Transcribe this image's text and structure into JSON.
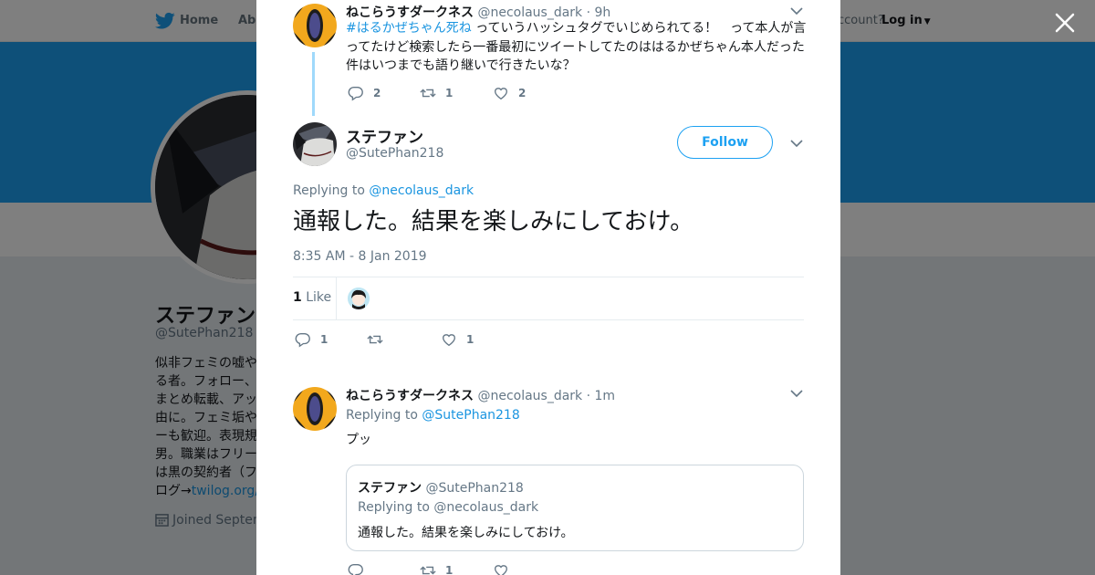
{
  "background": {
    "nav": {
      "home_label": "Home",
      "about_label": "Abo",
      "have_account_text": "ccount?",
      "login_label": "Log in"
    },
    "profile": {
      "name": "ステファン",
      "handle": "@SutePhan218",
      "bio_lines": [
        "似非フェミの嘘や",
        "る者。フォロー、",
        "まとめ転載、アッ",
        "由に。フェミ垢や",
        "ーも歓迎。表現規",
        "男。職業はフリー",
        "は黒の契約者（フ"
      ],
      "bio_last_prefix": "ログ→",
      "bio_link": "twilog.org/S",
      "joined": "Joined Septem"
    },
    "colors": {
      "header_blue": "#1da1f2",
      "overlay": "rgba(0,0,0,0.5)"
    }
  },
  "modal": {
    "close_icon": "close-icon",
    "parent_tweet": {
      "name": "ねこらうすダークネス",
      "handle": "@necolaus_dark",
      "time": "· 9h",
      "hashtag": "#はるかぜちゃん死ね",
      "text": " っていうハッシュタグでいじめられてる！　って本人が言ってたけど検索したら一番最初にツイートしてたのははるかぜちゃん本人だった件はいつまでも語り継いで行きたいな？",
      "replies": "2",
      "retweets": "1",
      "likes": "2"
    },
    "main_tweet": {
      "name": "ステファン",
      "handle": "@SutePhan218",
      "follow_label": "Follow",
      "replying_to_label": "Replying to",
      "replying_to_handle": "@necolaus_dark",
      "text": "通報した。結果を楽しみにしておけ。",
      "timestamp": "8:35 AM - 8 Jan 2019",
      "likes_count": "1",
      "likes_label": "Like",
      "replies": "1",
      "retweets": "",
      "likes": "1"
    },
    "reply_tweet": {
      "name": "ねこらうすダークネス",
      "handle": "@necolaus_dark",
      "time": "· 1m",
      "replying_to_label": "Replying to",
      "replying_to_handle": "@SutePhan218",
      "text": "プッ",
      "quote": {
        "name": "ステファン",
        "handle": "@SutePhan218",
        "replying_to": "Replying to @necolaus_dark",
        "text": "通報した。結果を楽しみにしておけ。"
      },
      "retweets": "1"
    },
    "colors": {
      "accent": "#1da1f2",
      "link": "#1b95e0",
      "muted": "#657786",
      "thread_line": "#9fd9fb"
    }
  }
}
